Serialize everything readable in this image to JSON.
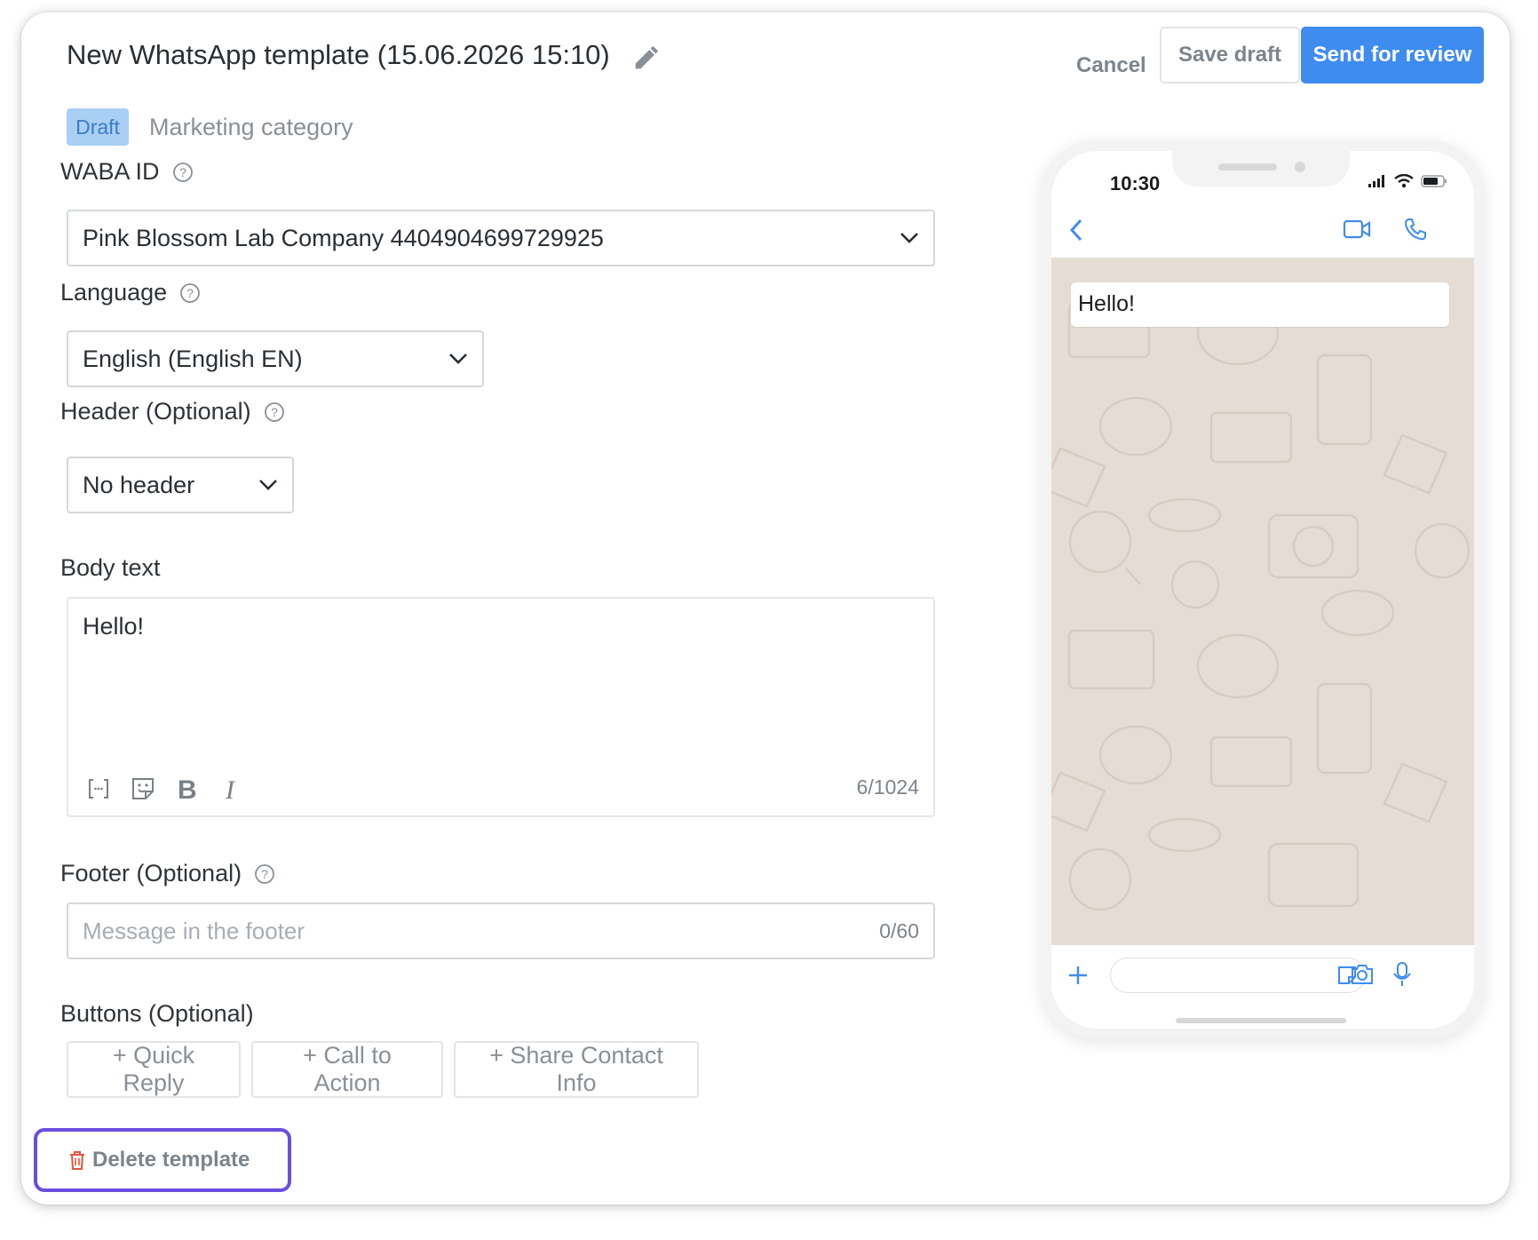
{
  "header": {
    "title": "New WhatsApp template (15.06.2026 15:10)",
    "cancel_label": "Cancel",
    "save_draft_label": "Save draft",
    "send_label": "Send for review"
  },
  "status": {
    "badge": "Draft",
    "category": "Marketing category"
  },
  "form": {
    "waba": {
      "label": "WABA ID",
      "value": "Pink Blossom Lab Company 4404904699729925"
    },
    "language": {
      "label": "Language",
      "value": "English (English EN)"
    },
    "header": {
      "label": "Header (Optional)",
      "value": "No header"
    },
    "body": {
      "label": "Body text",
      "value": "Hello!",
      "counter": "6/1024"
    },
    "footer": {
      "label": "Footer (Optional)",
      "placeholder": "Message in the footer",
      "counter": "0/60"
    },
    "buttons": {
      "label": "Buttons (Optional)",
      "items": [
        "+ Quick Reply",
        "+ Call to Action",
        "+ Share Contact Info"
      ]
    }
  },
  "delete_label": "Delete template",
  "preview": {
    "time": "10:30",
    "message": "Hello!"
  },
  "colors": {
    "accent": "#3f8cf1",
    "highlight_border": "#6a4ee0",
    "chat_bg": "#e5ddd5",
    "draft_badge_bg": "#a9cff5",
    "delete_icon": "#e5533d"
  }
}
